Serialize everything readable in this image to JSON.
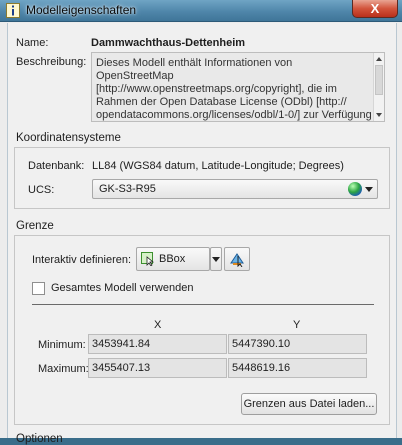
{
  "window": {
    "title": "Modelleigenschaften",
    "close_label": "X"
  },
  "model": {
    "name_label": "Name:",
    "name_value": "Dammwachthaus-Dettenheim",
    "description_label": "Beschreibung:",
    "description_value": "Dieses Modell enthält Informationen von OpenStreetMap [http://www.openstreetmaps.org/copyright], die im Rahmen der Open Database License (ODbl) [http:// opendatacommons.org/licenses/odbl/1-0/] zur Verfügung stehen. Geländedaten für die USA und"
  },
  "coords": {
    "section_label": "Koordinatensysteme",
    "datum_label": "Datenbank:",
    "datum_value": "LL84 (WGS84 datum, Latitude-Longitude; Degrees)",
    "ucs_label": "UCS:",
    "ucs_value": "GK-S3-R95"
  },
  "bounds": {
    "section_label": "Grenze",
    "interactive_label": "Interaktiv definieren:",
    "bbox_label": "BBox",
    "whole_model_label": "Gesamtes Modell verwenden",
    "whole_model_checked": false,
    "x_header": "X",
    "y_header": "Y",
    "min_label": "Minimum:",
    "min_x": "3453941.84",
    "min_y": "5447390.10",
    "max_label": "Maximum:",
    "max_x": "3455407.13",
    "max_y": "5448619.16",
    "load_button_label": "Grenzen aus Datei laden..."
  },
  "footer": {
    "next_section_label": "Optionen"
  }
}
